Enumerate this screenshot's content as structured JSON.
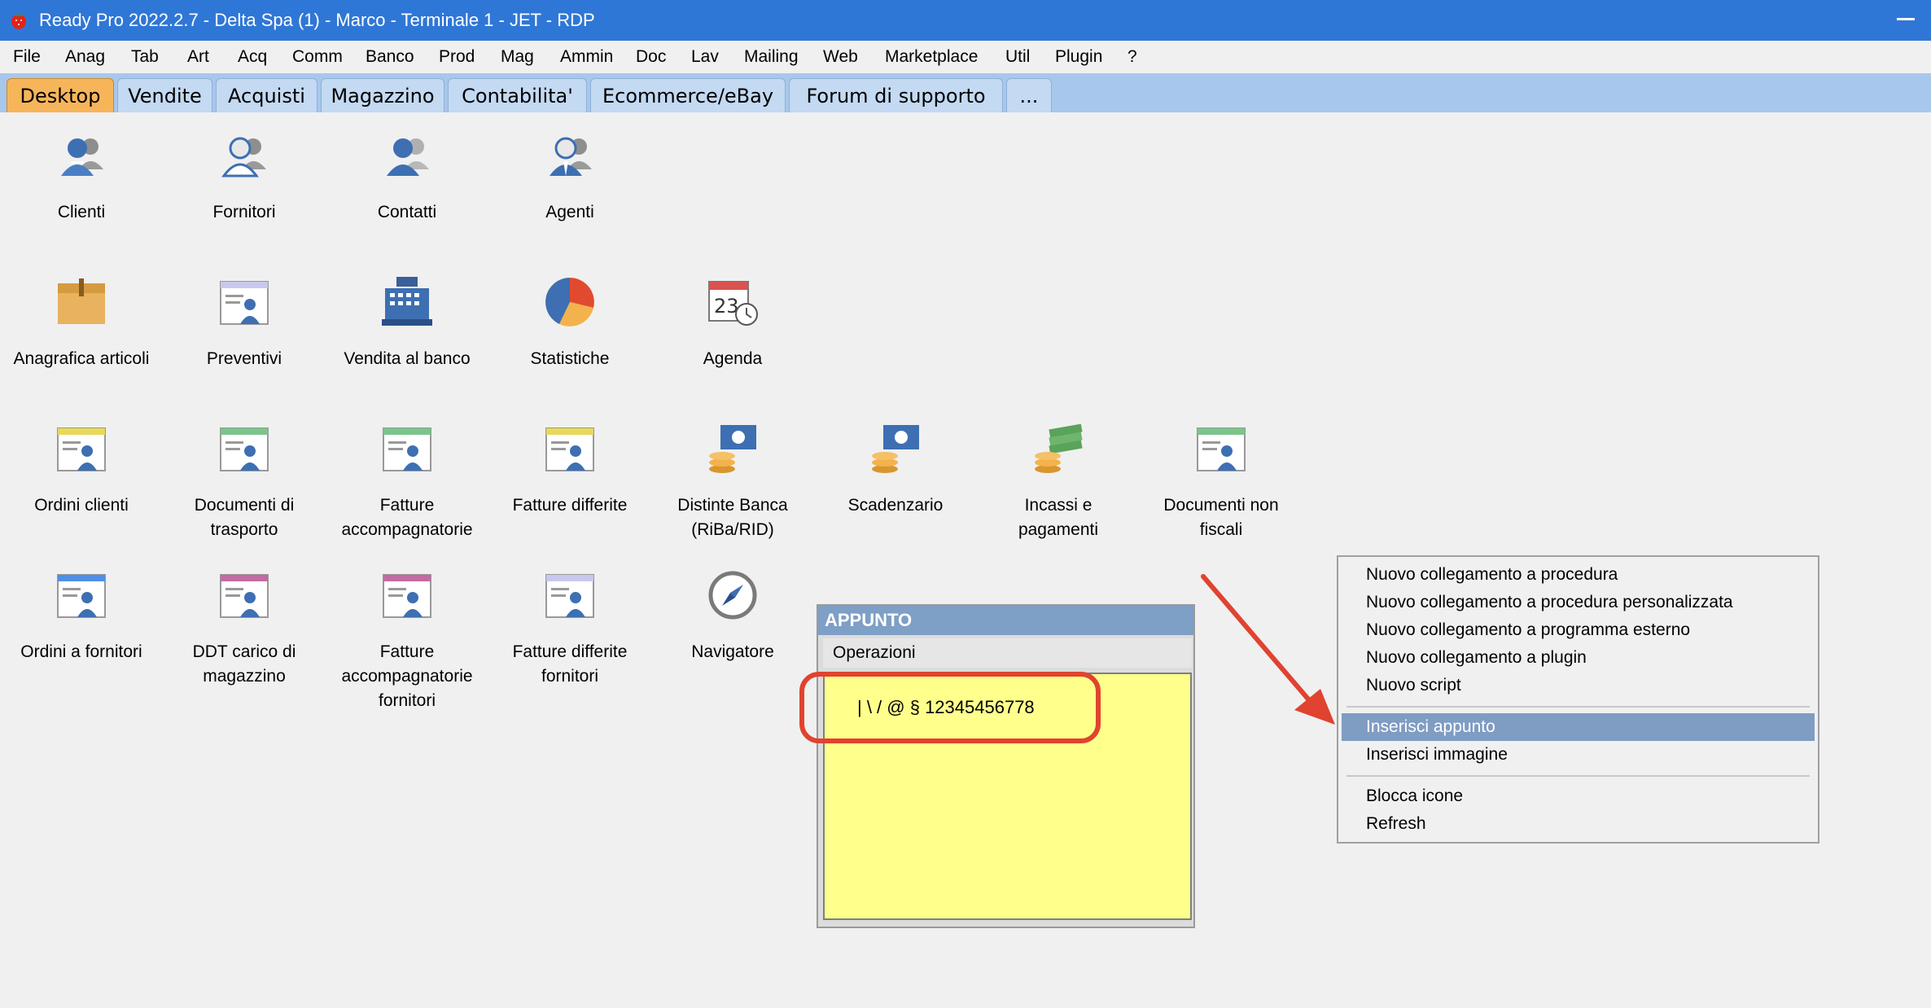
{
  "window": {
    "title": "Ready Pro 2022.2.7 - Delta Spa (1) - Marco - Terminale 1 - JET - RDP",
    "app_icon": "strawberry-app-icon"
  },
  "menubar": [
    "File",
    "Anag",
    "Tab",
    "Art",
    "Acq",
    "Comm",
    "Banco",
    "Prod",
    "Mag",
    "Ammin",
    "Doc",
    "Lav",
    "Mailing",
    "Web",
    "Marketplace",
    "Util",
    "Plugin",
    "?"
  ],
  "tabs": [
    {
      "label": "Desktop",
      "active": true
    },
    {
      "label": "Vendite",
      "active": false
    },
    {
      "label": "Acquisti",
      "active": false
    },
    {
      "label": "Magazzino",
      "active": false
    },
    {
      "label": "Contabilita'",
      "active": false
    },
    {
      "label": "Ecommerce/eBay",
      "active": false
    },
    {
      "label": "Forum di supporto",
      "active": false
    },
    {
      "label": "...",
      "active": false
    }
  ],
  "desktop": {
    "items": [
      {
        "label": "Clienti",
        "icon": "clienti-icon"
      },
      {
        "label": "Fornitori",
        "icon": "fornitori-icon"
      },
      {
        "label": "Contatti",
        "icon": "contatti-icon"
      },
      {
        "label": "Agenti",
        "icon": "agenti-icon"
      },
      {
        "label": "Anagrafica articoli",
        "icon": "box-icon"
      },
      {
        "label": "Preventivi",
        "icon": "document-user-icon"
      },
      {
        "label": "Vendita al banco",
        "icon": "cash-register-icon"
      },
      {
        "label": "Statistiche",
        "icon": "pie-chart-icon"
      },
      {
        "label": "Agenda",
        "icon": "calendar-clock-icon"
      },
      {
        "label": "Ordini clienti",
        "icon": "document-user-icon"
      },
      {
        "label": "Documenti di\ntrasporto",
        "icon": "document-user-icon"
      },
      {
        "label": "Fatture\naccompagnatorie",
        "icon": "document-user-icon"
      },
      {
        "label": "Fatture differite",
        "icon": "document-user-icon"
      },
      {
        "label": "Distinte Banca\n(RiBa/RID)",
        "icon": "money-coins-icon"
      },
      {
        "label": "Scadenzario",
        "icon": "money-coins-icon"
      },
      {
        "label": "Incassi e\npagamenti",
        "icon": "cash-stack-icon"
      },
      {
        "label": "Documenti non\nfiscali",
        "icon": "document-user-icon"
      },
      {
        "label": "Ordini a fornitori",
        "icon": "document-user-icon"
      },
      {
        "label": "DDT carico di\nmagazzino",
        "icon": "document-user-icon"
      },
      {
        "label": "Fatture\naccompagnatorie\nfornitori",
        "icon": "document-user-icon"
      },
      {
        "label": "Fatture differite\nfornitori",
        "icon": "document-user-icon"
      },
      {
        "label": "Navigatore",
        "icon": "compass-icon"
      }
    ]
  },
  "note": {
    "title": "APPUNTO",
    "operations_label": "Operazioni",
    "text": "| \\ / @ § 12345456778"
  },
  "context_menu": {
    "items": [
      {
        "label": "Nuovo collegamento a procedura"
      },
      {
        "label": "Nuovo collegamento a procedura personalizzata"
      },
      {
        "label": "Nuovo collegamento a programma esterno"
      },
      {
        "label": "Nuovo collegamento a plugin"
      },
      {
        "label": "Nuovo script"
      },
      {
        "label": "Inserisci appunto",
        "selected": true
      },
      {
        "label": "Inserisci immagine"
      },
      {
        "label": "Blocca icone"
      },
      {
        "label": "Refresh"
      }
    ]
  },
  "colors": {
    "titlebar": "#2f77d6",
    "tab_active": "#f7b55a",
    "tabbar": "#a8c7ec",
    "note_body": "#ffff8c",
    "highlight": "#e0432f",
    "menu_selected": "#7f9cc3"
  }
}
